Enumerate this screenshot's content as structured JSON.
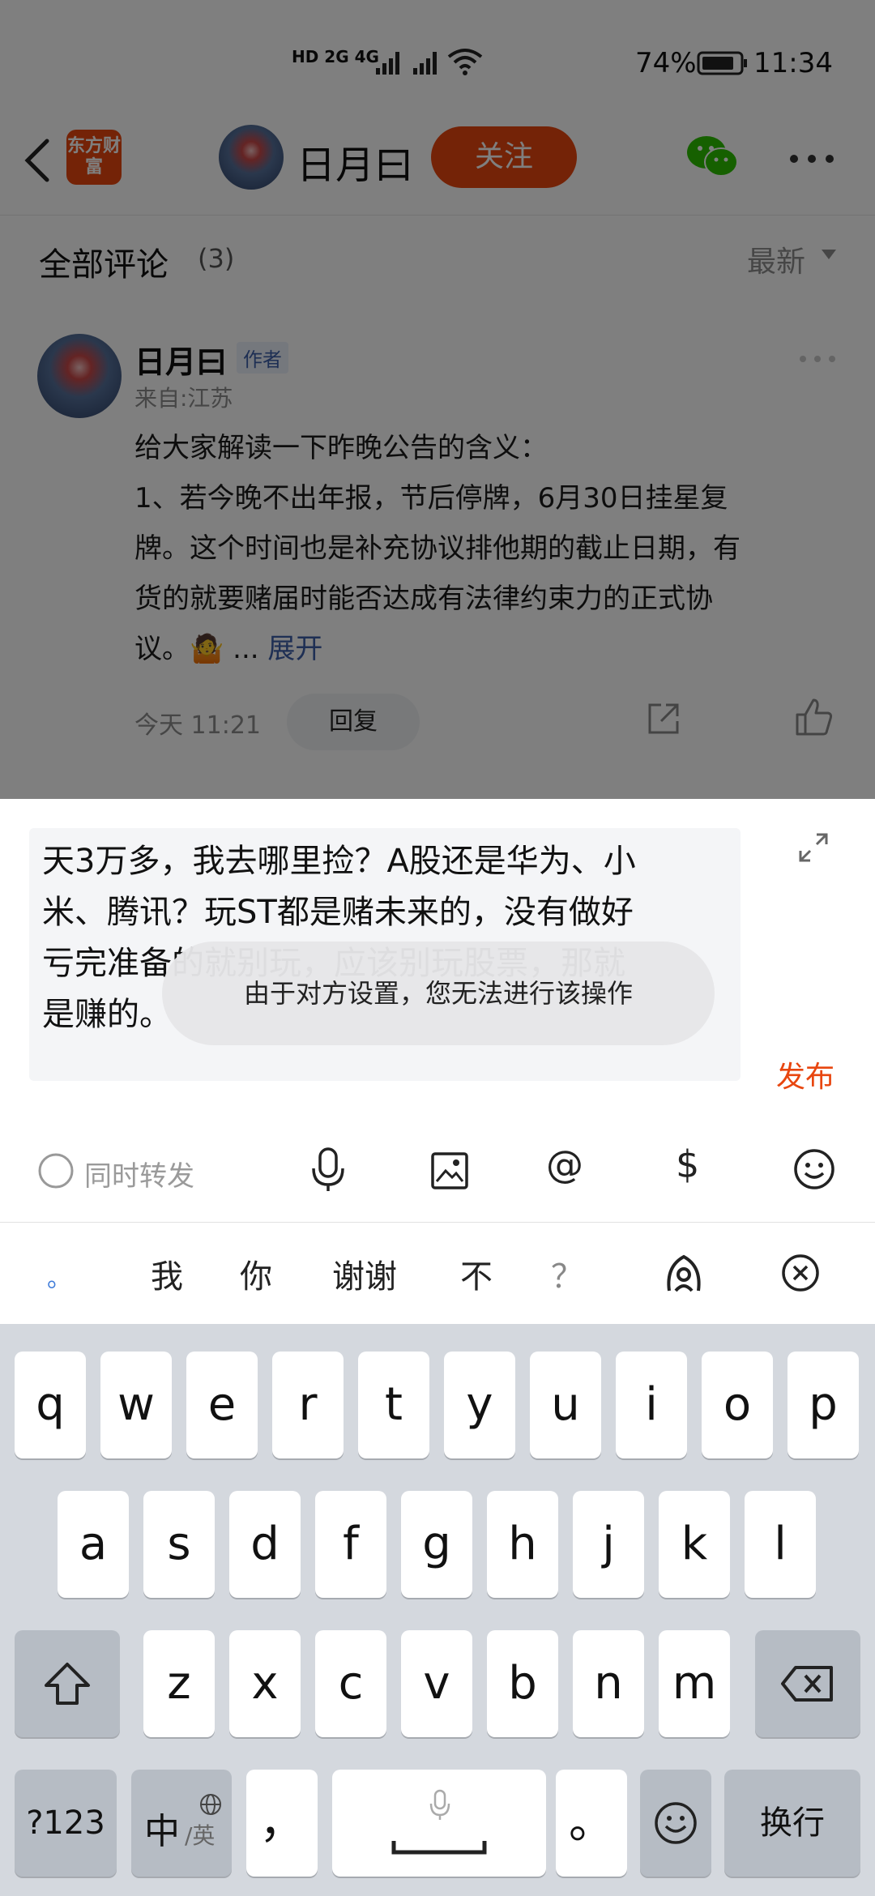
{
  "status_bar": {
    "network": "HD 2G 4G",
    "battery": "74%",
    "time": "11:34"
  },
  "header": {
    "app_logo": "东方财富",
    "author_name": "日月曰",
    "follow_label": "关注"
  },
  "comments_section": {
    "title": "全部评论",
    "count": "(3)",
    "sort_label": "最新"
  },
  "comment": {
    "author": "日月曰",
    "author_tag": "作者",
    "location": "来自:江苏",
    "lines": [
      "给大家解读一下昨晚公告的含义：",
      "1、若今晚不出年报，节后停牌，6月30日挂星复",
      "牌。这个时间也是补充协议排他期的截止日期，有",
      "货的就要赌届时能否达成有法律约束力的正式协",
      "议。🤷 ..."
    ],
    "expand_label": "展开",
    "time": "今天 11:21",
    "reply_label": "回复"
  },
  "composer": {
    "lines": [
      "天3万多，我去哪里捡？A股还是华为、小",
      "米、腾讯？玩ST都是赌未来的，没有做好",
      "亏完准备的就别玩，应该别玩股票，那就",
      "是赚的。"
    ],
    "toast": "由于对方设置，您无法进行该操作",
    "publish_label": "发布",
    "repost_label": "同时转发"
  },
  "suggestions": [
    "。",
    "我",
    "你",
    "谢谢",
    "不",
    "？"
  ],
  "keyboard": {
    "row1": [
      "q",
      "w",
      "e",
      "r",
      "t",
      "y",
      "u",
      "i",
      "o",
      "p"
    ],
    "row2": [
      "a",
      "s",
      "d",
      "f",
      "g",
      "h",
      "j",
      "k",
      "l"
    ],
    "row3": [
      "z",
      "x",
      "c",
      "v",
      "b",
      "n",
      "m"
    ],
    "num_label": "?123",
    "lang_main": "中",
    "lang_sub": "/英",
    "comma": "，",
    "period": "。",
    "enter_label": "换行"
  },
  "colors": {
    "accent": "#e8460f",
    "link": "#3d5fa8",
    "keyboard_bg": "#d4d8de"
  }
}
